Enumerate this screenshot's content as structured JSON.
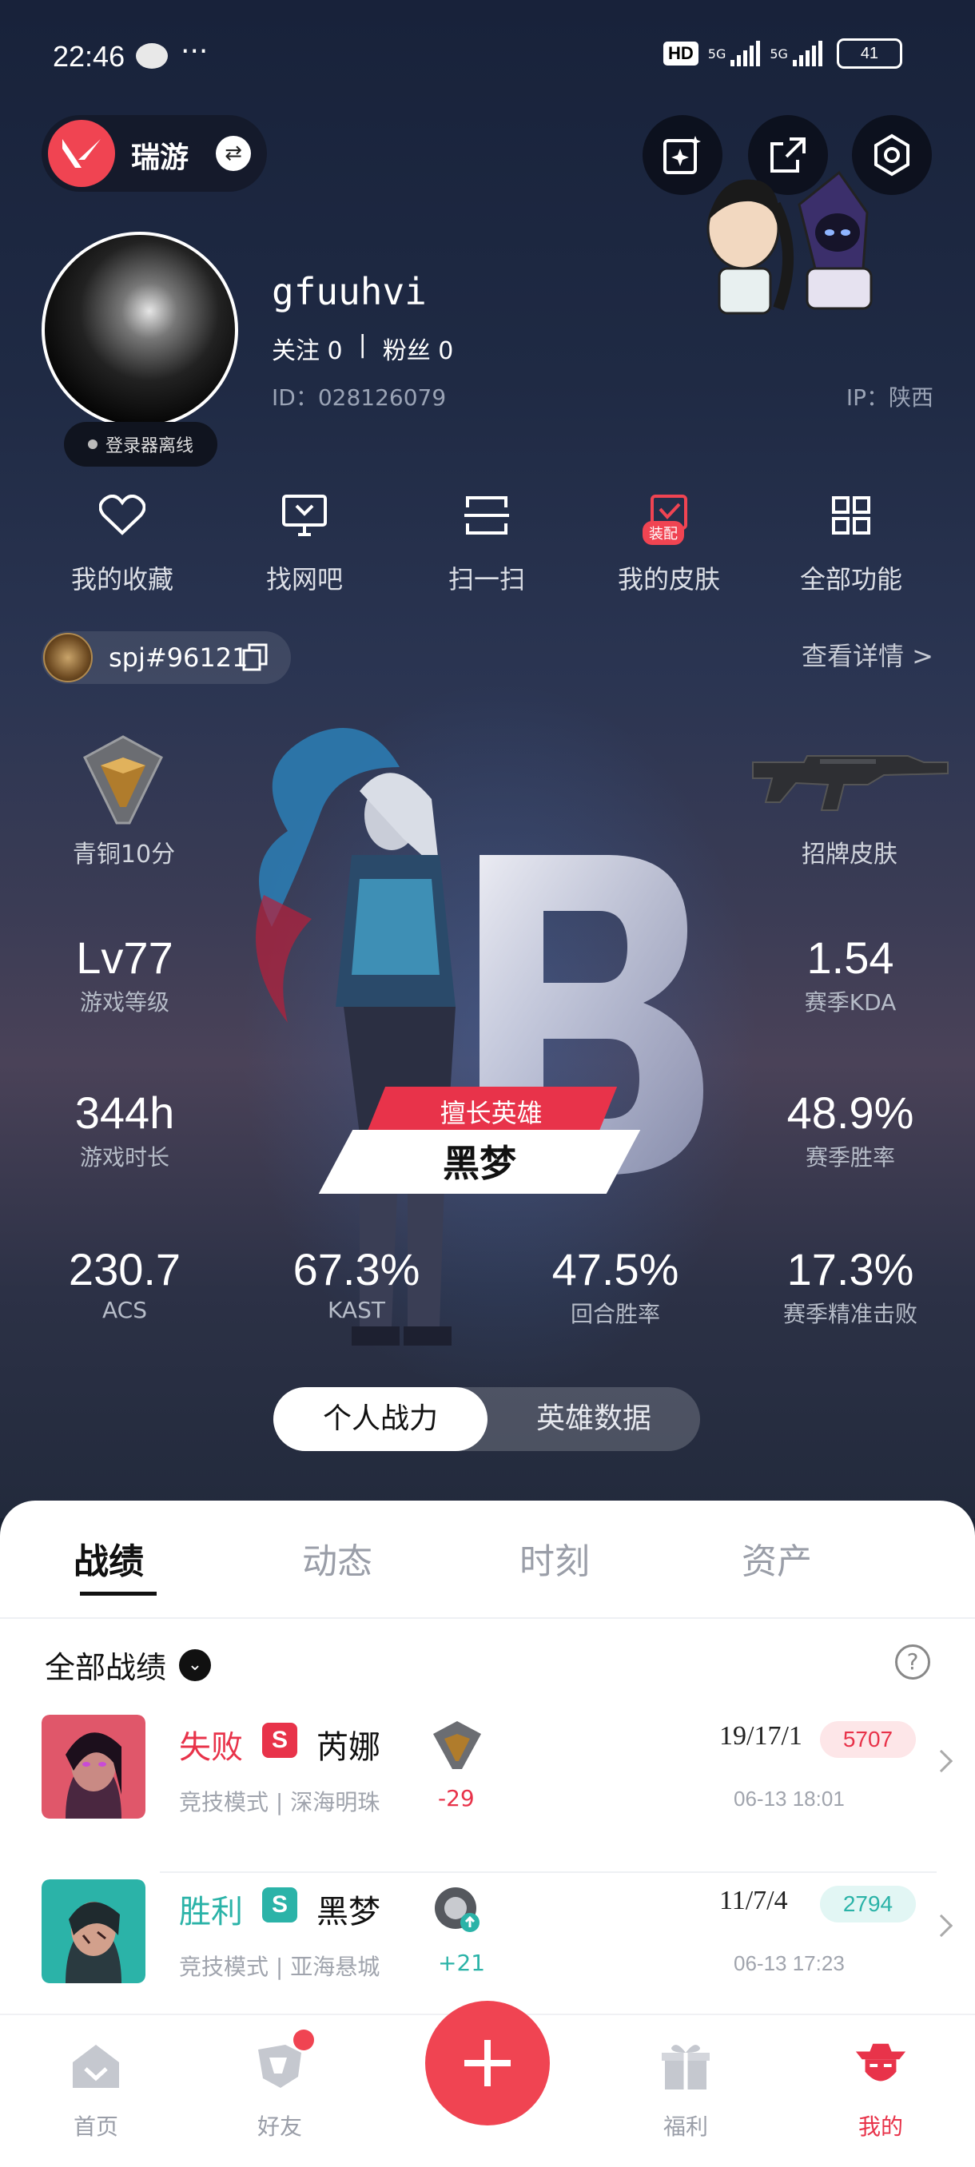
{
  "status_bar": {
    "time": "22:46",
    "hd": "HD",
    "network": "5G",
    "battery": "41"
  },
  "header": {
    "brand": "瑞游"
  },
  "profile": {
    "username": "gfuuhvi",
    "follow_label": "关注 0",
    "separator": "|",
    "fans_label": "粉丝 0",
    "id_text": "ID：028126079",
    "ip_text": "IP：陕西",
    "online_status": "登录器离线"
  },
  "functions": [
    {
      "label": "我的收藏",
      "icon": "heart-icon"
    },
    {
      "label": "找网吧",
      "icon": "monitor-icon"
    },
    {
      "label": "扫一扫",
      "icon": "scan-icon"
    },
    {
      "label": "我的皮肤",
      "icon": "skin-icon",
      "badge": "装配"
    },
    {
      "label": "全部功能",
      "icon": "grid-icon"
    }
  ],
  "account": {
    "name": "spj#96121",
    "detail_link": "查看详情 >"
  },
  "stats": {
    "rank_label": "青铜10分",
    "skin_label": "招牌皮肤",
    "level": {
      "value": "Lv77",
      "label": "游戏等级"
    },
    "kda": {
      "value": "1.54",
      "label": "赛季KDA"
    },
    "playtime": {
      "value": "344h",
      "label": "游戏时长"
    },
    "winrate": {
      "value": "48.9%",
      "label": "赛季胜率"
    },
    "acs": {
      "value": "230.7",
      "label": "ACS"
    },
    "kast": {
      "value": "67.3%",
      "label": "KAST"
    },
    "round_win": {
      "value": "47.5%",
      "label": "回合胜率"
    },
    "precision": {
      "value": "17.3%",
      "label": "赛季精准击败"
    }
  },
  "hero": {
    "tag": "擅长英雄",
    "name": "黑梦"
  },
  "toggle": {
    "active": "个人战力",
    "inactive": "英雄数据"
  },
  "tabs": [
    "战绩",
    "动态",
    "时刻",
    "资产"
  ],
  "filter": {
    "label": "全部战绩",
    "help": "?"
  },
  "matches": [
    {
      "result": "失败",
      "result_color": "#e8334a",
      "s_label": "S",
      "agent": "芮娜",
      "mode": "竞技模式 | 深海明珠",
      "delta": "-29",
      "delta_color": "#e8334a",
      "kda": "19/17/1",
      "score": "5707",
      "score_bg": "#fde6e8",
      "score_color": "#e8334a",
      "time": "06-13 18:01"
    },
    {
      "result": "胜利",
      "result_color": "#2bb3a8",
      "s_label": "S",
      "agent": "黑梦",
      "mode": "竞技模式 | 亚海悬城",
      "delta": "+21",
      "delta_color": "#2bb3a8",
      "kda": "11/7/4",
      "score": "2794",
      "score_bg": "#e2f6f4",
      "score_color": "#2bb3a8",
      "time": "06-13 17:23"
    }
  ],
  "nav": [
    {
      "label": "首页",
      "icon": "home-icon"
    },
    {
      "label": "好友",
      "icon": "friends-icon"
    },
    {
      "label": "福利",
      "icon": "gift-icon"
    },
    {
      "label": "我的",
      "icon": "profile-icon"
    }
  ],
  "colors": {
    "accent": "#f04452",
    "win": "#2bb3a8",
    "loss": "#e8334a"
  }
}
